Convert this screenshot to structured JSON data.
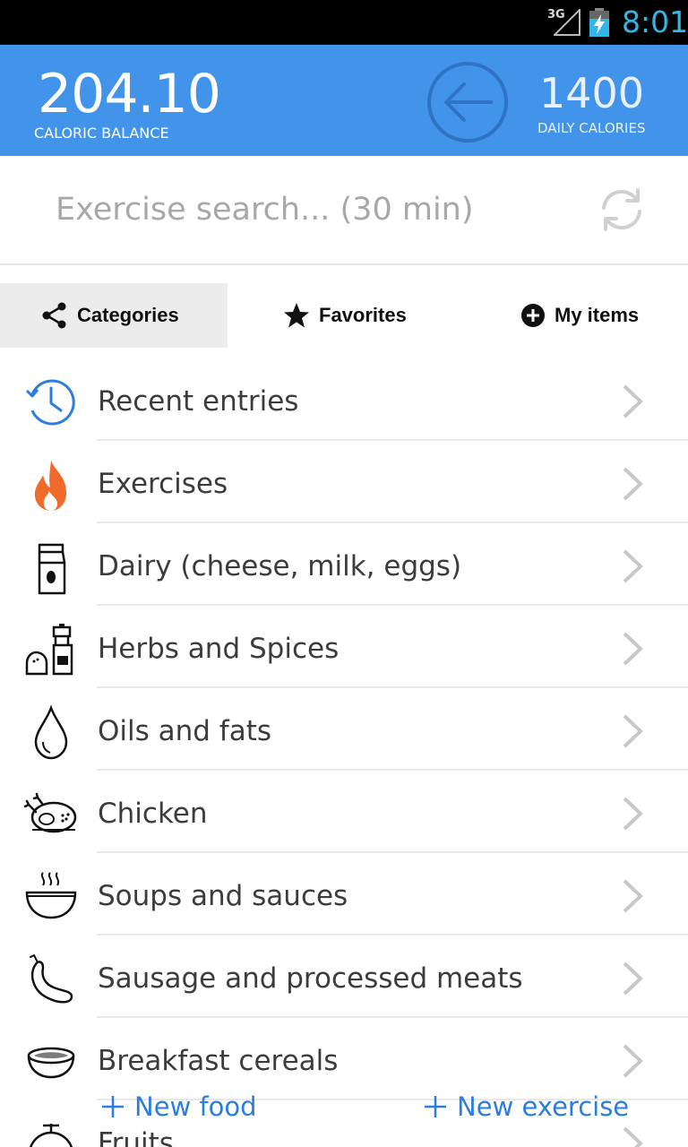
{
  "status_bar": {
    "network": "3G",
    "time": "8:01"
  },
  "header": {
    "balance_value": "204.10",
    "balance_label": "CALORIC BALANCE",
    "daily_value": "1400",
    "daily_label": "DAILY CALORIES",
    "accent": "#4293ea"
  },
  "search": {
    "placeholder": "Exercise search... (30 min)"
  },
  "tabs": [
    {
      "label": "Categories",
      "icon": "share-icon",
      "active": true
    },
    {
      "label": "Favorites",
      "icon": "star-icon",
      "active": false
    },
    {
      "label": "My items",
      "icon": "plus-circle-icon",
      "active": false
    }
  ],
  "categories": [
    {
      "label": "Recent entries",
      "icon": "clock-history-icon"
    },
    {
      "label": "Exercises",
      "icon": "flame-icon"
    },
    {
      "label": "Dairy (cheese, milk, eggs)",
      "icon": "milk-carton-icon"
    },
    {
      "label": "Herbs and Spices",
      "icon": "pepper-grinder-icon"
    },
    {
      "label": "Oils and fats",
      "icon": "oil-drop-icon"
    },
    {
      "label": "Chicken",
      "icon": "roast-chicken-icon"
    },
    {
      "label": "Soups and sauces",
      "icon": "soup-bowl-icon"
    },
    {
      "label": "Sausage and processed meats",
      "icon": "sausage-icon"
    },
    {
      "label": "Breakfast cereals",
      "icon": "cereal-bowl-icon"
    },
    {
      "label": "Fruits",
      "icon": "fruit-icon"
    }
  ],
  "actions": {
    "new_food": "New food",
    "new_exercise": "New exercise"
  }
}
